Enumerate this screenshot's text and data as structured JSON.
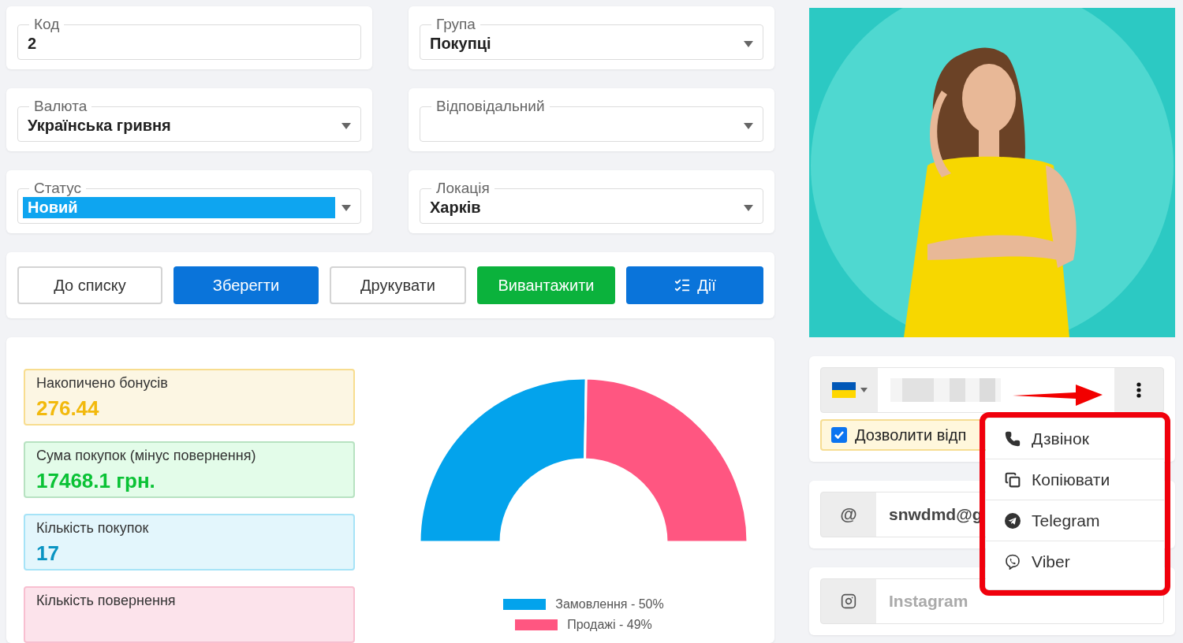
{
  "fields": [
    {
      "label": "Код",
      "value": "2",
      "kind": "text",
      "highlighted": false
    },
    {
      "label": "Група",
      "value": "Покупці",
      "kind": "select",
      "highlighted": false
    },
    {
      "label": "Валюта",
      "value": "Українська гривня",
      "kind": "select",
      "highlighted": false
    },
    {
      "label": "Відповідальний",
      "kind": "select",
      "highlighted": false
    },
    {
      "label": "Статус",
      "value": "Новий",
      "kind": "select",
      "highlighted": true
    },
    {
      "label": "Локація",
      "value": "Харків",
      "kind": "select",
      "highlighted": false
    }
  ],
  "buttons": [
    {
      "label": "До списку",
      "kind": "outline"
    },
    {
      "label": "Зберегти",
      "kind": "primary"
    },
    {
      "label": "Друкувати",
      "kind": "outline"
    },
    {
      "label": "Вивантажити",
      "kind": "success"
    },
    {
      "label": "Дії",
      "kind": "actions"
    }
  ],
  "stats": [
    {
      "label": "Накопичено бонусів",
      "value": "276.44",
      "color": "#f8dd8f"
    },
    {
      "label": "Сума покупок (мінус повернення)",
      "value": "17468.1 грн.",
      "color": "#b7e2c1"
    },
    {
      "label": "Кількість покупок",
      "value": "17",
      "color": "#a6e3f7"
    },
    {
      "label": "Кількість повернення",
      "color": "#f8bfd0"
    }
  ],
  "chart": {
    "chart_data": {
      "type": "donut",
      "categories": [
        "Замовлення - 50%",
        "Продажі - 49%"
      ],
      "values": [
        50,
        49
      ]
    },
    "legend": [
      {
        "color": "#03a3ec"
      },
      {
        "color": "#ff5681"
      }
    ]
  },
  "contact": {
    "phone_prefix": {
      "kind": "flag"
    },
    "allow": {
      "label": "Дозволити відп",
      "checked": true
    },
    "email": {
      "prefix": "@",
      "value": "snwdmd@g"
    },
    "instagram": {
      "placeholder": "Instagram"
    }
  },
  "menu": {
    "items": [
      {
        "label": "Дзвінок",
        "kind": "call"
      },
      {
        "label": "Копіювати",
        "kind": "copy"
      },
      {
        "label": "Telegram",
        "kind": "telegram"
      },
      {
        "label": "Viber",
        "kind": "viber"
      }
    ]
  }
}
